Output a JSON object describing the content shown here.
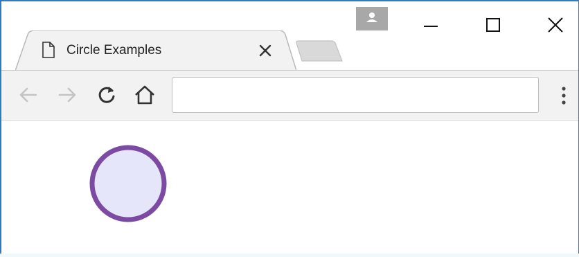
{
  "tab": {
    "title": "Circle Examples",
    "icon": "document-icon"
  },
  "window_controls": [
    "minimize-icon",
    "maximize-icon",
    "close-icon"
  ],
  "toolbar": {
    "nav": [
      "back-arrow-icon",
      "forward-arrow-icon",
      "reload-icon",
      "home-icon"
    ],
    "address_value": "",
    "menu_icon": "kebab-menu-icon"
  },
  "content": {
    "shape": "circle",
    "fill_color": "#e6e6fa",
    "stroke_color": "#7c4aa3"
  },
  "colors": {
    "window_border": "#2b7bc7",
    "toolbar_bg": "#f2f2f2",
    "avatar_bg": "#a8a8a8"
  }
}
